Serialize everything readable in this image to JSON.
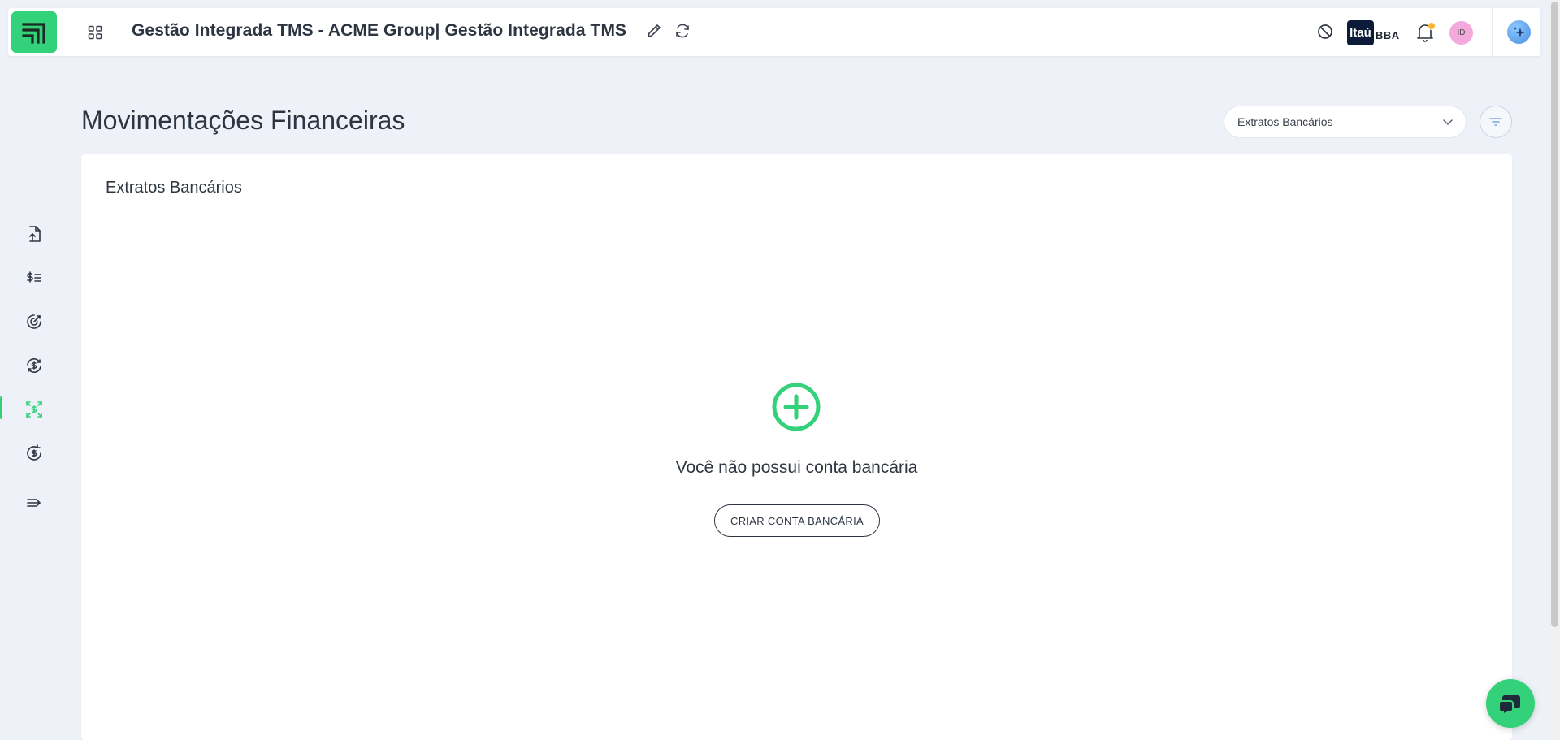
{
  "header": {
    "app_title": "Gestão Integrada TMS - ACME Group| Gestão Integrada TMS",
    "bank": {
      "mark": "Itaú",
      "suffix": "BBA"
    },
    "avatar_initials": "ID",
    "icons": {
      "logo": "brand-logo-icon",
      "apps": "grid-apps-icon",
      "edit": "pencil-icon",
      "refresh": "refresh-icon",
      "block": "block-icon",
      "notifications": "bell-icon",
      "assistant": "sparkle-icon"
    }
  },
  "sidebar": {
    "items": [
      {
        "icon": "file-upload-icon",
        "active": false
      },
      {
        "icon": "dollar-list-icon",
        "active": false
      },
      {
        "icon": "target-icon",
        "active": false
      },
      {
        "icon": "dollar-exchange-icon",
        "active": false
      },
      {
        "icon": "dollar-expand-icon",
        "active": true
      },
      {
        "icon": "dollar-refresh-icon",
        "active": false
      },
      {
        "icon": "collapse-menu-icon",
        "active": false
      }
    ]
  },
  "page": {
    "title": "Movimentações Financeiras",
    "view_select": {
      "value": "Extratos Bancários"
    }
  },
  "card": {
    "title": "Extratos Bancários",
    "empty_message": "Você não possui conta bancária",
    "create_button": "CRIAR CONTA BANCÁRIA"
  },
  "colors": {
    "accent": "#33d17a",
    "background": "#eef1f7",
    "text": "#2d3542",
    "notification_dot": "#f5b731",
    "avatar": "#f4a9dc"
  }
}
